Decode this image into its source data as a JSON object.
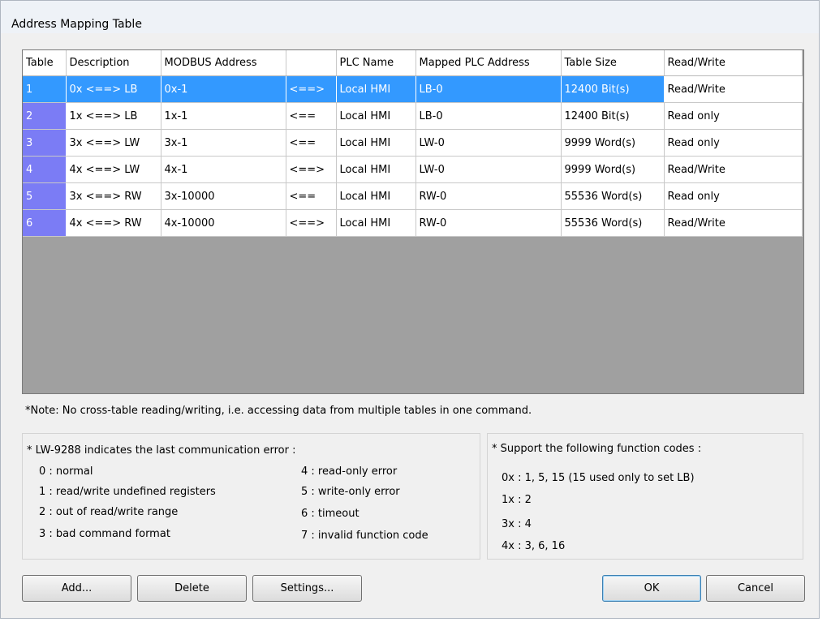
{
  "window": {
    "title": "Address Mapping Table"
  },
  "table": {
    "columns": [
      "Table",
      "Description",
      "MODBUS Address",
      "",
      "PLC Name",
      "Mapped PLC Address",
      "Table Size",
      "Read/Write"
    ],
    "rows": [
      [
        "1",
        "0x <==> LB",
        "0x-1",
        "<==>",
        "Local HMI",
        "LB-0",
        "12400 Bit(s)",
        "Read/Write"
      ],
      [
        "2",
        "1x <==> LB",
        "1x-1",
        "<==",
        "Local HMI",
        "LB-0",
        "12400 Bit(s)",
        "Read only"
      ],
      [
        "3",
        "3x <==> LW",
        "3x-1",
        "<==",
        "Local HMI",
        "LW-0",
        "9999 Word(s)",
        "Read only"
      ],
      [
        "4",
        "4x <==> LW",
        "4x-1",
        "<==>",
        "Local HMI",
        "LW-0",
        "9999 Word(s)",
        "Read/Write"
      ],
      [
        "5",
        "3x <==> RW",
        "3x-10000",
        "<==",
        "Local HMI",
        "RW-0",
        "55536 Word(s)",
        "Read only"
      ],
      [
        "6",
        "4x <==> RW",
        "4x-10000",
        "<==>",
        "Local HMI",
        "RW-0",
        "55536 Word(s)",
        "Read/Write"
      ]
    ]
  },
  "note": "*Note: No cross-table reading/writing, i.e. accessing data from multiple tables in one command.",
  "errors": {
    "title": "* LW-9288 indicates the last communication error :",
    "left": [
      "0 : normal",
      "1 : read/write undefined registers",
      "2 : out of read/write range",
      "3 : bad command format"
    ],
    "right": [
      "4 : read-only error",
      "5 : write-only error",
      "6 : timeout",
      "7 : invalid function code"
    ]
  },
  "functions": {
    "title": "* Support the following function codes :",
    "items": [
      "0x : 1, 5, 15 (15 used only to set LB)",
      "1x : 2",
      "3x : 4",
      "4x : 3, 6, 16"
    ]
  },
  "buttons": {
    "add": "Add...",
    "delete": "Delete",
    "settings": "Settings...",
    "ok": "OK",
    "cancel": "Cancel"
  },
  "colors": {
    "selected_row": "#3399ff",
    "row_number_cell": "#7b7cf5",
    "empty_grid_area": "#a0a0a0"
  }
}
